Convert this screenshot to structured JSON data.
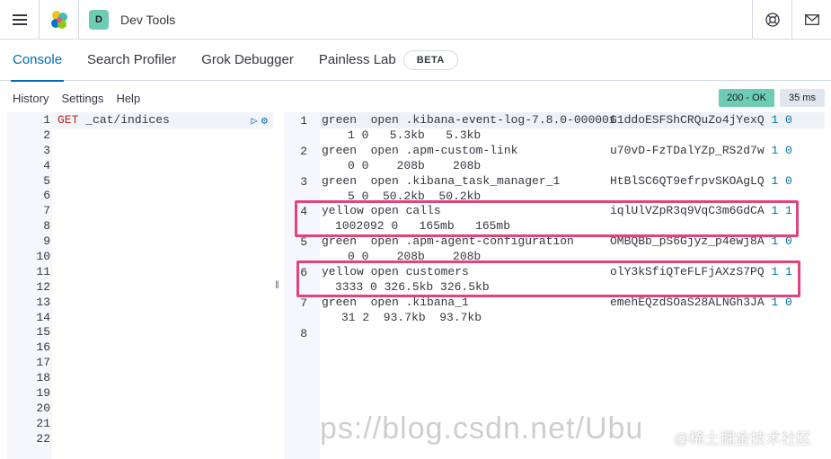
{
  "header": {
    "app_title": "Dev Tools",
    "space_initial": "D"
  },
  "tabs": [
    {
      "label": "Console",
      "active": true
    },
    {
      "label": "Search Profiler"
    },
    {
      "label": "Grok Debugger"
    },
    {
      "label": "Painless Lab"
    }
  ],
  "beta_label": "BETA",
  "topnav": {
    "history": "History",
    "settings": "Settings",
    "help": "Help"
  },
  "status": {
    "ok": "200 - OK",
    "time": "35 ms"
  },
  "request": {
    "method": "GET",
    "path": "_cat/indices",
    "line_numbers": [
      "1",
      "2",
      "3",
      "4",
      "5",
      "6",
      "7",
      "8",
      "9",
      "10",
      "11",
      "12",
      "13",
      "14",
      "15",
      "16",
      "17",
      "18",
      "19",
      "20",
      "21",
      "22"
    ]
  },
  "response": {
    "rows": [
      {
        "num": "1",
        "line1_left": "green  open .kibana-event-log-7.8.0-000001",
        "uuid": "G1ddoESFShCRQuZo4jYexQ",
        "p": "1 0",
        "line2": "1 0   5.3kb   5.3kb"
      },
      {
        "num": "2",
        "line1_left": "green  open .apm-custom-link",
        "uuid": "u70vD-FzTDalYZp_RS2d7w",
        "p": "1 0",
        "line2": "0 0    208b    208b"
      },
      {
        "num": "3",
        "line1_left": "green  open .kibana_task_manager_1",
        "uuid": "HtBlSC6QT9efrpvSKOAgLQ",
        "p": "1 0",
        "line2": "5 0  50.2kb  50.2kb"
      },
      {
        "num": "4",
        "line1_left": "yellow open calls",
        "uuid": "iqlUlVZpR3q9VqC3m6GdCA",
        "p": "1 1",
        "line2": "1002092 0   165mb   165mb"
      },
      {
        "num": "5",
        "line1_left": "green  open .apm-agent-configuration",
        "uuid": "OMBQBb_pS6Gjyz_p4ewj8A",
        "p": "1 0",
        "line2": "0 0    208b    208b"
      },
      {
        "num": "6",
        "line1_left": "yellow open customers",
        "uuid": "olY3kSfiQTeFLFjAXzS7PQ",
        "p": "1 1",
        "line2": "3333 0 326.5kb 326.5kb"
      },
      {
        "num": "7",
        "line1_left": "green  open .kibana_1",
        "uuid": "emehEQzdSOaS28ALNGh3JA",
        "p": "1 0",
        "line2": "31 2  93.7kb  93.7kb"
      }
    ],
    "last_line": "8"
  },
  "watermark": "ps://blog.csdn.net/Ubu",
  "cn_watermark": "@稀土掘金技术社区",
  "colors": {
    "accent": "#006bb4",
    "success": "#6dccb1",
    "highlight": "#e0447c"
  }
}
